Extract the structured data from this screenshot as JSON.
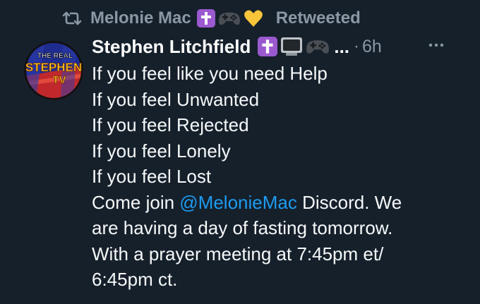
{
  "retweet": {
    "icon": "retweet-icon",
    "user_name": "Melonie Mac",
    "emojis": [
      "latin-cross-emoji",
      "video-game-controller-emoji",
      "yellow-heart-emoji"
    ],
    "label": "Retweeted"
  },
  "tweet": {
    "author": {
      "display_name": "Stephen Litchfield",
      "emojis": [
        "latin-cross-emoji",
        "television-emoji",
        "video-game-controller-emoji"
      ],
      "truncation": "...",
      "separator": "·",
      "timestamp": "6h",
      "avatar": {
        "icon": "channel-logo-avatar",
        "text_top": "THE REAL",
        "text_mid": "STEPHEN",
        "text_bottom": "TV"
      }
    },
    "more_icon": "more-options-icon",
    "lines": [
      "If you feel like you need Help",
      "If you feel Unwanted",
      "If you feel Rejected",
      "If you feel Lonely",
      "If you feel Lost"
    ],
    "join_prefix": "Come join ",
    "mention": "@MelonieMac",
    "join_suffix": " Discord. We",
    "continuation_lines": [
      "are having a day of fasting tomorrow.",
      "With a prayer meeting at 7:45pm et/",
      "6:45pm ct."
    ]
  },
  "colors": {
    "background": "#15202b",
    "muted_text": "#8b98a5",
    "primary_text": "#f7f9f9",
    "link": "#1d9bf0",
    "cross_emoji_bg": "#9b59d0",
    "heart": "#f8c43a"
  }
}
